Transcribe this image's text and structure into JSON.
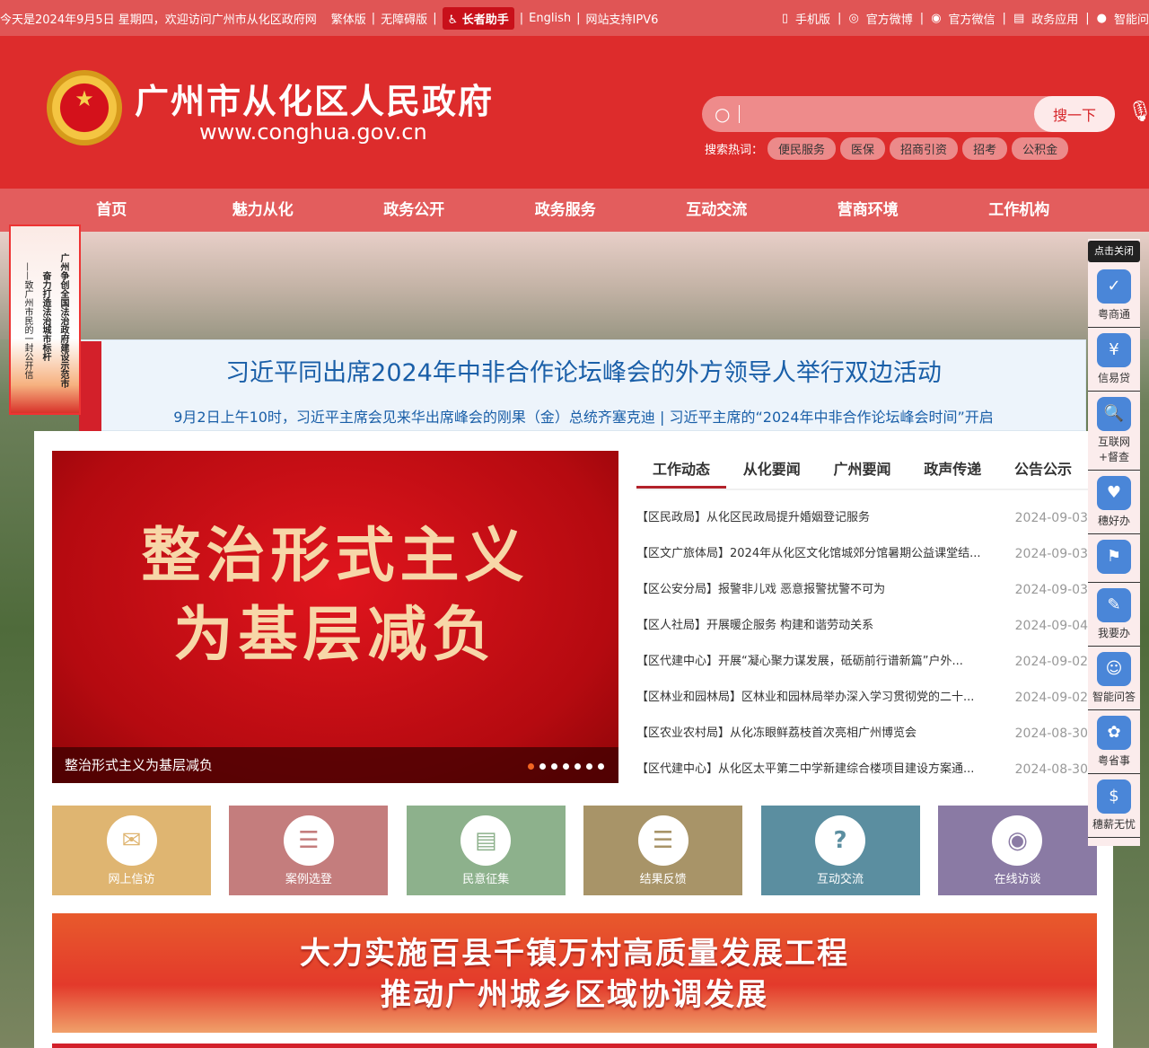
{
  "topbar": {
    "greeting": "今天是2024年9月5日 星期四，欢迎访问广州市从化区政府网",
    "traditional": "繁体版",
    "accessible": "无障碍版",
    "elder": "长者助手",
    "english": "English",
    "ipv6": "网站支持IPV6",
    "mobile": "手机版",
    "weibo": "官方微博",
    "wechat": "官方微信",
    "apps": "政务应用",
    "smart": "智能问"
  },
  "header": {
    "title": "广州市从化区人民政府",
    "url": "www.conghua.gov.cn",
    "search_button": "搜一下",
    "hot_label": "搜索热词：",
    "hot": [
      "便民服务",
      "医保",
      "招商引资",
      "招考",
      "公积金"
    ]
  },
  "nav": [
    "首页",
    "魅力从化",
    "政务公开",
    "政务服务",
    "互动交流",
    "营商环境",
    "工作机构"
  ],
  "float_left": {
    "line1": "广州争创全国法治政府建设示范市",
    "line2": "奋力打造法治城市标杆",
    "line3": "——致广州市民的一封公开信"
  },
  "headline": {
    "title": "习近平同出席2024年中非合作论坛峰会的外方领导人举行双边活动",
    "sub": "9月2日上午10时，习近平主席会见来华出席峰会的刚果（金）总统齐塞克迪 | 习近平主席的“2024年中非合作论坛峰会时间”开启"
  },
  "slider": {
    "big1": "整治形式主义",
    "big2": "为基层减负",
    "caption": "整治形式主义为基层减负",
    "slides": 7,
    "active": 1
  },
  "tabs": [
    "工作动态",
    "从化要闻",
    "广州要闻",
    "政声传递",
    "公告公示"
  ],
  "news": [
    {
      "t": "【区民政局】从化区民政局提升婚姻登记服务",
      "d": "2024-09-03"
    },
    {
      "t": "【区文广旅体局】2024年从化区文化馆城郊分馆暑期公益课堂结...",
      "d": "2024-09-03"
    },
    {
      "t": "【区公安分局】报警非儿戏 恶意报警扰警不可为",
      "d": "2024-09-03"
    },
    {
      "t": "【区人社局】开展暖企服务 构建和谐劳动关系",
      "d": "2024-09-04"
    },
    {
      "t": "【区代建中心】开展“凝心聚力谋发展，砥砺前行谱新篇”户外...",
      "d": "2024-09-02"
    },
    {
      "t": "【区林业和园林局】区林业和园林局举办深入学习贯彻党的二十...",
      "d": "2024-09-02"
    },
    {
      "t": "【区农业农村局】从化冻眼鲜荔枝首次亮相广州博览会",
      "d": "2024-08-30"
    },
    {
      "t": "【区代建中心】从化区太平第二中学新建综合楼项目建设方案通...",
      "d": "2024-08-30"
    }
  ],
  "tiles": [
    {
      "label": "网上信访",
      "color": "#dfb571",
      "icon": "✉"
    },
    {
      "label": "案例选登",
      "color": "#c47d7d",
      "icon": "☰"
    },
    {
      "label": "民意征集",
      "color": "#8db18c",
      "icon": "▤"
    },
    {
      "label": "结果反馈",
      "color": "#a89468",
      "icon": "☰"
    },
    {
      "label": "互动交流",
      "color": "#5b8ea0",
      "icon": "?"
    },
    {
      "label": "在线访谈",
      "color": "#8a7aa4",
      "icon": "◉"
    }
  ],
  "banner2": {
    "line1": "大力实施百县千镇万村高质量发展工程",
    "line2": "推动广州城乡区域协调发展"
  },
  "rightbar": {
    "close": "点击关闭",
    "items": [
      "粤商通",
      "信易贷",
      "互联网+督查",
      "穗好办",
      "",
      "我要办",
      "智能问答",
      "粤省事",
      "穗薪无忧"
    ]
  }
}
